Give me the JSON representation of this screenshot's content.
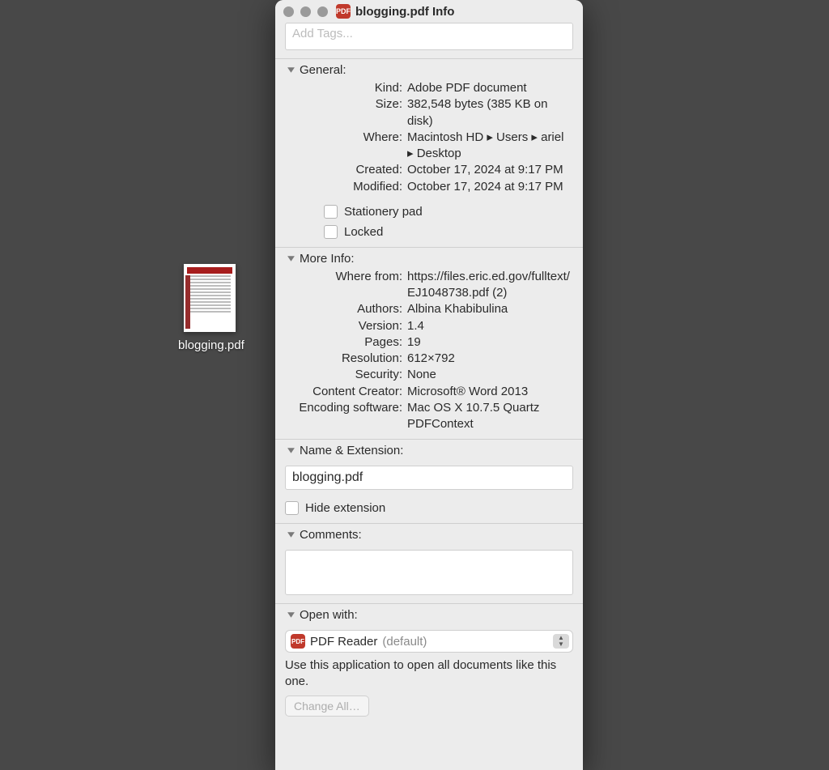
{
  "desktop": {
    "file_label": "blogging.pdf"
  },
  "window": {
    "title": "blogging.pdf Info",
    "tags_placeholder": "Add Tags..."
  },
  "sections": {
    "general": {
      "title": "General:",
      "kind_label": "Kind:",
      "kind_value": "Adobe PDF document",
      "size_label": "Size:",
      "size_value": "382,548 bytes (385 KB on disk)",
      "where_label": "Where:",
      "where_value": "Macintosh HD ▸ Users ▸ ariel ▸ Desktop",
      "created_label": "Created:",
      "created_value": "October 17, 2024 at 9:17 PM",
      "modified_label": "Modified:",
      "modified_value": "October 17, 2024 at 9:17 PM",
      "stationery_label": "Stationery pad",
      "locked_label": "Locked"
    },
    "more_info": {
      "title": "More Info:",
      "where_from_label": "Where from:",
      "where_from_value": "https://files.eric.ed.gov/fulltext/EJ1048738.pdf (2)",
      "authors_label": "Authors:",
      "authors_value": "Albina Khabibulina",
      "version_label": "Version:",
      "version_value": "1.4",
      "pages_label": "Pages:",
      "pages_value": "19",
      "resolution_label": "Resolution:",
      "resolution_value": "612×792",
      "security_label": "Security:",
      "security_value": "None",
      "content_creator_label": "Content Creator:",
      "content_creator_value": "Microsoft® Word 2013",
      "encoding_label": "Encoding software:",
      "encoding_value": "Mac OS X 10.7.5 Quartz PDFContext"
    },
    "name_ext": {
      "title": "Name & Extension:",
      "value": "blogging.pdf",
      "hide_ext_label": "Hide extension"
    },
    "comments": {
      "title": "Comments:"
    },
    "open_with": {
      "title": "Open with:",
      "app_name": "PDF Reader",
      "app_default": "(default)",
      "note": "Use this application to open all documents like this one.",
      "change_all": "Change All…"
    }
  }
}
